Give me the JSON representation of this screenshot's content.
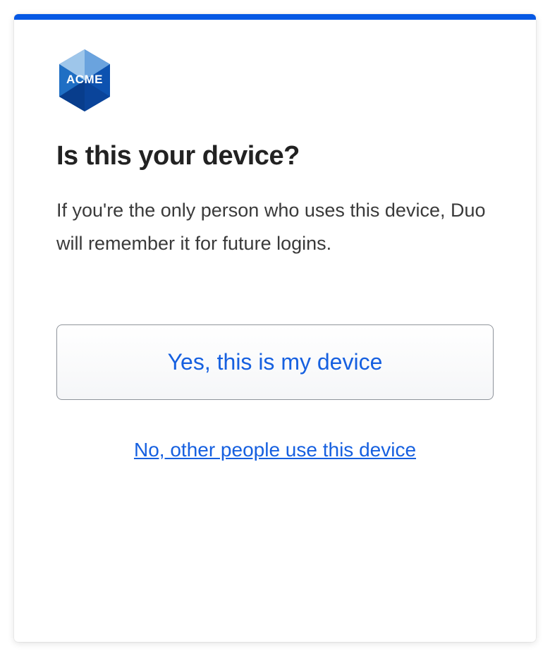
{
  "logo": {
    "text": "ACME"
  },
  "heading": "Is this your device?",
  "description": "If you're the only person who uses this device, Duo will remember it for future logins.",
  "buttons": {
    "primary": "Yes, this is my device",
    "secondary": "No, other people use this device"
  },
  "colors": {
    "accent": "#0558e4",
    "link": "#1660e0"
  }
}
